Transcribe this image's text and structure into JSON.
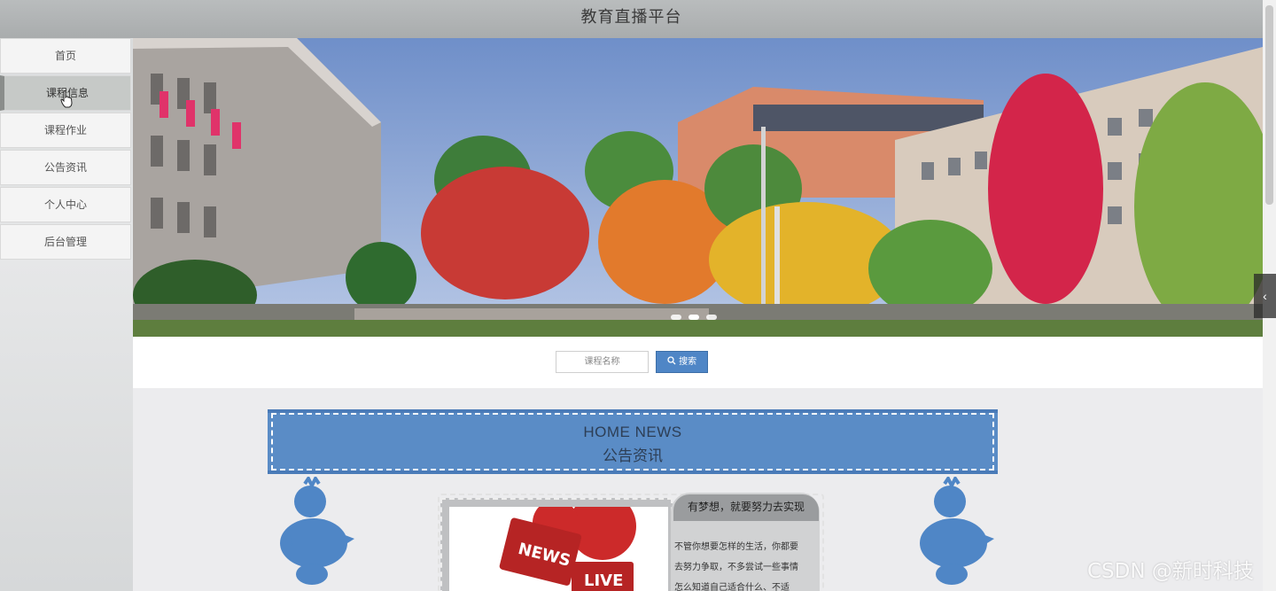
{
  "header": {
    "title": "教育直播平台"
  },
  "sidebar": {
    "items": [
      {
        "label": "首页"
      },
      {
        "label": "课程信息"
      },
      {
        "label": "课程作业"
      },
      {
        "label": "公告资讯"
      },
      {
        "label": "个人中心"
      },
      {
        "label": "后台管理"
      }
    ],
    "active_index": 1
  },
  "carousel": {
    "dots": 3,
    "active_dot": 1,
    "next_icon": "chevron-left-icon"
  },
  "search": {
    "placeholder": "课程名称",
    "button_label": "搜索",
    "button_icon": "search-icon"
  },
  "news_section": {
    "title_en": "HOME NEWS",
    "title_zh": "公告资讯"
  },
  "news_card": {
    "image_labels": {
      "news": "NEWS",
      "live": "LIVE"
    },
    "title": "有梦想，就要努力去实现",
    "body_lines": [
      "不管你想要怎样的生活，你都要",
      "去努力争取，不多尝试一些事情",
      "怎么知道自己适合什么、不适"
    ]
  },
  "watermark": "CSDN @新时科技",
  "colors": {
    "accent": "#5a8cc6",
    "header": "#b0b3b4",
    "button": "#4f86c6"
  }
}
